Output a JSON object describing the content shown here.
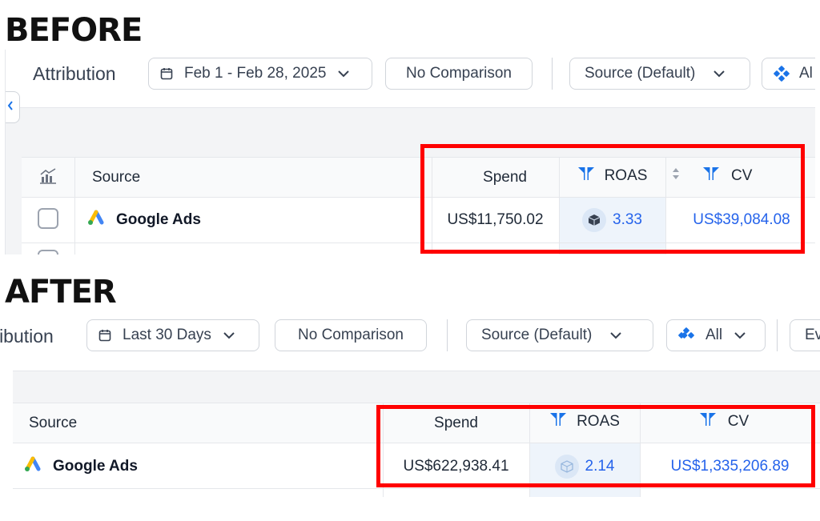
{
  "before": {
    "heading": "BEFORE",
    "toolbar": {
      "title": "Attribution",
      "date_range": "Feb 1 - Feb 28, 2025",
      "comparison": "No Comparison",
      "source": "Source (Default)",
      "filter": "Al"
    },
    "table": {
      "columns": {
        "source": "Source",
        "spend": "Spend",
        "roas": "ROAS",
        "cv": "CV"
      },
      "rows": [
        {
          "source": "Google Ads",
          "spend": "US$11,750.02",
          "roas": "3.33",
          "cv": "US$39,084.08"
        }
      ]
    }
  },
  "after": {
    "heading": "AFTER",
    "toolbar": {
      "title": "ibution",
      "date_range": "Last 30 Days",
      "comparison": "No Comparison",
      "source": "Source (Default)",
      "filter": "All",
      "extra": "Ev"
    },
    "table": {
      "columns": {
        "source": "Source",
        "spend": "Spend",
        "roas": "ROAS",
        "cv": "CV"
      },
      "rows": [
        {
          "source": "Google Ads",
          "spend": "US$622,938.41",
          "roas": "2.14",
          "cv": "US$1,335,206.89"
        }
      ]
    }
  },
  "colors": {
    "accent": "#1a73e8",
    "link": "#2563eb",
    "highlight": "#ff0000"
  },
  "icons": [
    "calendar-icon",
    "chevron-down-icon",
    "filter-icon",
    "funnel-icon",
    "chart-icon",
    "google-ads-icon",
    "sort-icon",
    "cube-icon",
    "chevron-left-icon"
  ]
}
